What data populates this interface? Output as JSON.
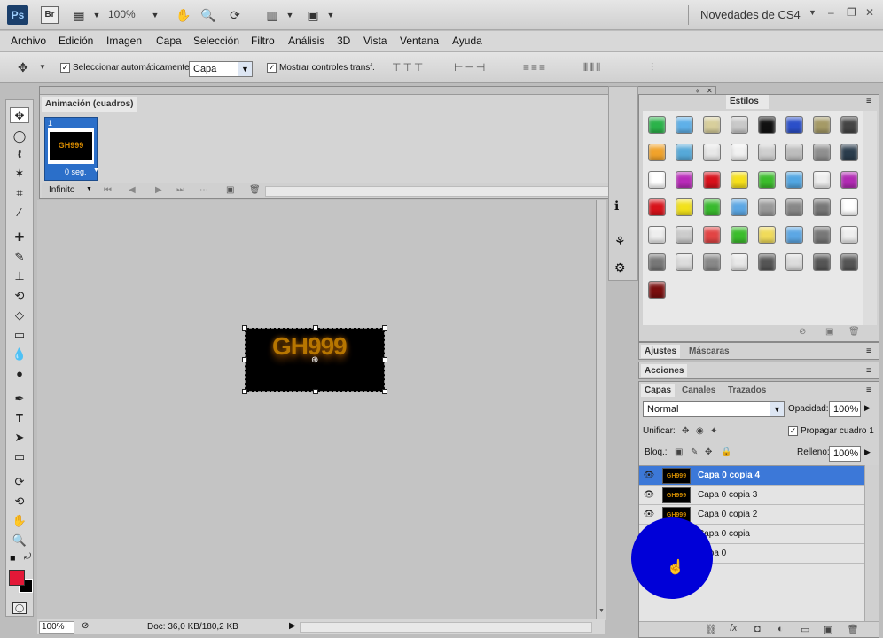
{
  "app": {
    "logo": "Ps",
    "bridge": "Br",
    "zoom": "100%",
    "workspace": "Novedades de CS4",
    "window_controls": [
      "–",
      "❐",
      "✕"
    ]
  },
  "menu": [
    "Archivo",
    "Edición",
    "Imagen",
    "Capa",
    "Selección",
    "Filtro",
    "Análisis",
    "3D",
    "Vista",
    "Ventana",
    "Ayuda"
  ],
  "options": {
    "auto_select_label": "Seleccionar automáticamente:",
    "auto_select_value": "Capa",
    "show_transform_label": "Mostrar controles transf."
  },
  "animation": {
    "title": "Animación (cuadros)",
    "frame_number": "1",
    "frame_delay": "0 seg.",
    "loop": "Infinito"
  },
  "canvas": {
    "image_text": "GH999"
  },
  "status": {
    "zoom": "100%",
    "doc": "Doc: 36,0 KB/180,2 KB"
  },
  "styles": {
    "tab": "Estilos",
    "swatch_colors": [
      "#2bb34a",
      "#5fb0e8",
      "#d8cf9c",
      "#c9c9c9",
      "#111111",
      "#2b4fc9",
      "#a59a66",
      "#444444",
      "#f1a32b",
      "#56a9d9",
      "#e8e8e8",
      "#f1f1f1",
      "#cfcfcf",
      "#bdbdbd",
      "#8f8f8f",
      "#2a3c4c",
      "#ffffff",
      "#b82ab8",
      "#d8111b",
      "#f6e01b",
      "#3bbd2c",
      "#52a6e2",
      "#eeeeee",
      "#b12ab3",
      "#d8121a",
      "#f2e11b",
      "#38ba2d",
      "#5ca7e4",
      "#999999",
      "#888888",
      "#777777",
      "#ffffff",
      "#eeeeee",
      "#cccccc",
      "#e24444",
      "#3bbd2c",
      "#f0db5a",
      "#5ca7e4",
      "#777777",
      "#eeeeee",
      "#777777",
      "#dddddd",
      "#888888",
      "#e8e8e8",
      "#555555",
      "#dddddd",
      "#555555",
      "#555555",
      "#7a0e0e"
    ]
  },
  "panels": {
    "ajustes": "Ajustes",
    "mascaras": "Máscaras",
    "acciones": "Acciones",
    "capas": "Capas",
    "canales": "Canales",
    "trazados": "Trazados"
  },
  "layers": {
    "blend_mode": "Normal",
    "opacity_label": "Opacidad:",
    "opacity": "100%",
    "unify_label": "Unificar:",
    "propagate_label": "Propagar cuadro 1",
    "lock_label": "Bloq.:",
    "fill_label": "Relleno:",
    "fill": "100%",
    "items": [
      {
        "name": "Capa 0 copia 4",
        "thumb": "GH999"
      },
      {
        "name": "Capa 0 copia 3",
        "thumb": "GH999"
      },
      {
        "name": "Capa 0 copia 2",
        "thumb": "GH999"
      },
      {
        "name": "Capa 0 copia",
        "thumb": ""
      },
      {
        "name": "Capa 0",
        "thumb": ""
      }
    ]
  }
}
